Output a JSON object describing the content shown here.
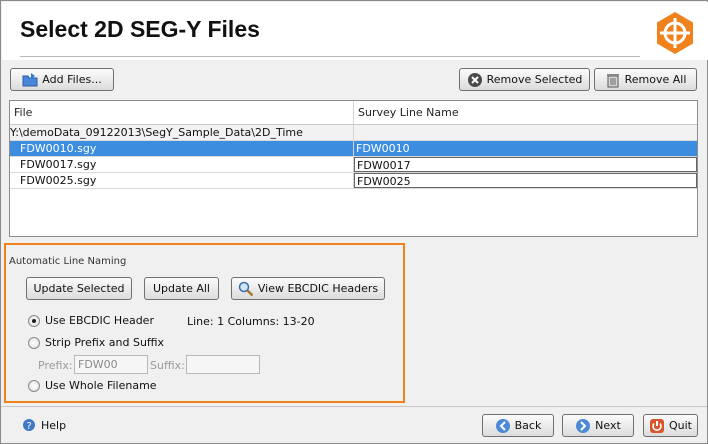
{
  "window": {
    "title": "Select 2D SEG-Y Files"
  },
  "toolbar": {
    "add_files": "Add Files...",
    "remove_selected": "Remove Selected",
    "remove_all": "Remove All"
  },
  "table": {
    "columns": [
      "File",
      "Survey Line Name"
    ],
    "group_path": "Y:\\demoData_09122013\\SegY_Sample_Data\\2D_Time",
    "rows": [
      {
        "file": "FDW0010.sgy",
        "line": "FDW0010",
        "selected": true
      },
      {
        "file": "FDW0017.sgy",
        "line": "FDW0017",
        "selected": false
      },
      {
        "file": "FDW0025.sgy",
        "line": "FDW0025",
        "selected": false
      }
    ]
  },
  "naming": {
    "group_label": "Automatic Line Naming",
    "update_selected": "Update Selected",
    "update_all": "Update All",
    "view_ebcdic": "View EBCDIC Headers",
    "use_ebcdic": "Use EBCDIC Header",
    "ebcdic_info": "Line: 1 Columns: 13-20",
    "strip_prefix": "Strip Prefix and Suffix",
    "prefix_label": "Prefix:",
    "prefix_value": "FDW00",
    "suffix_label": "Suffix:",
    "suffix_value": "",
    "use_filename": "Use Whole Filename",
    "selected_option": "use_ebcdic"
  },
  "footer": {
    "help": "Help",
    "back": "Back",
    "next": "Next",
    "quit": "Quit"
  },
  "colors": {
    "accent": "#f0821e",
    "selection": "#3c8de0"
  }
}
